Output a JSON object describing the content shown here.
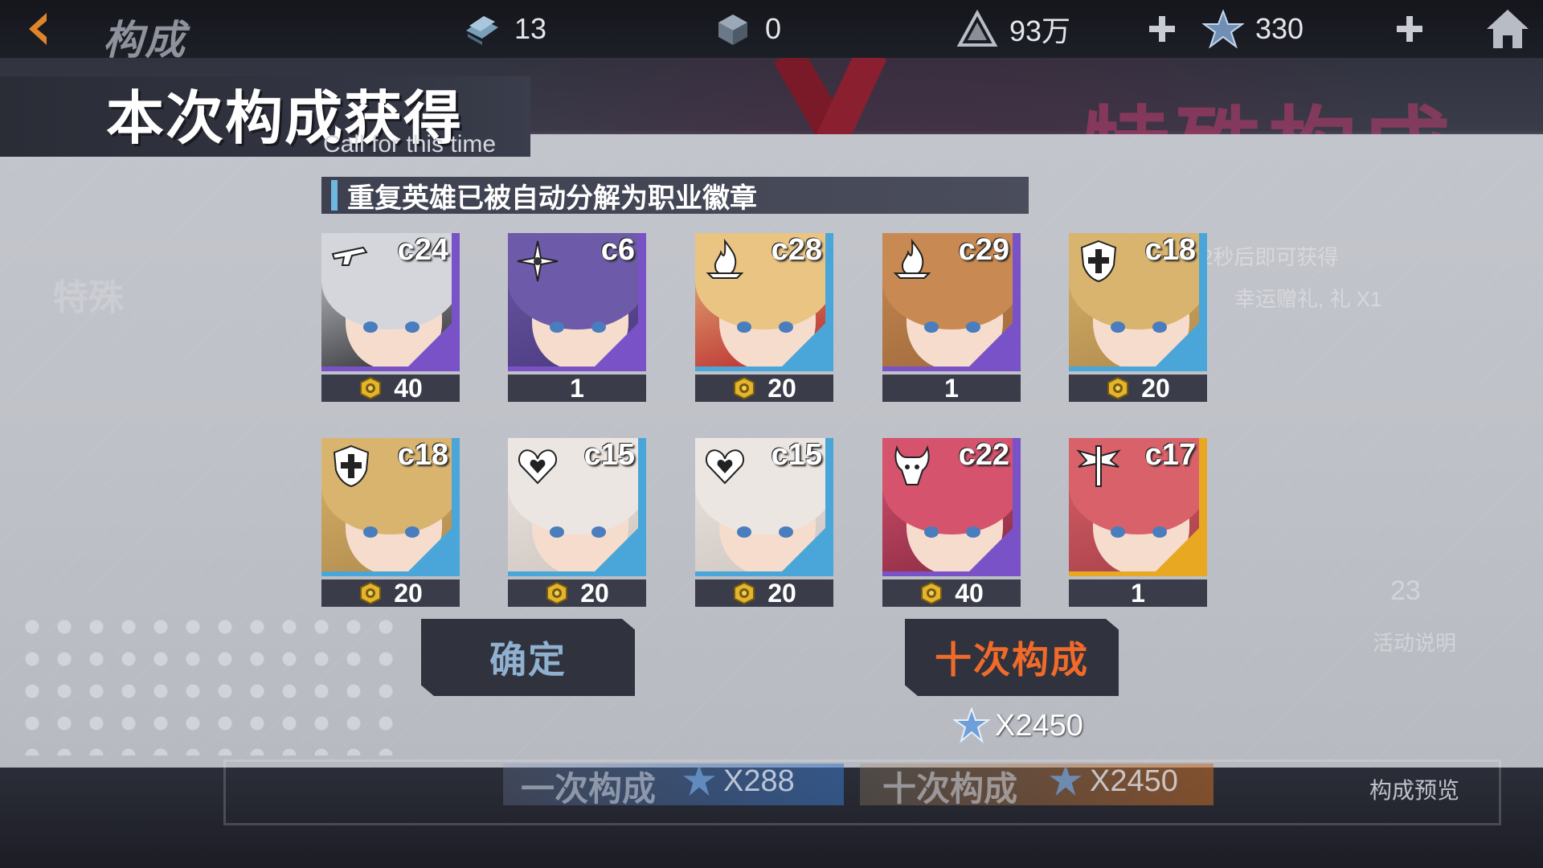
{
  "topbar": {
    "title": "构成",
    "resources": [
      {
        "icon": "card-stack-icon",
        "value": "13"
      },
      {
        "icon": "cube-icon",
        "value": "0"
      },
      {
        "icon": "gold-pyramid-icon",
        "value": "93万"
      },
      {
        "icon": "star-crystal-icon",
        "value": "330"
      }
    ]
  },
  "background": {
    "event_title": "特殊构成",
    "tab_special": "特殊",
    "event_desc_line1": "7分42秒后即可获得",
    "event_desc_line2": "幸运赠礼, 礼 X1",
    "activity_label": "活动说明",
    "calendar_number": "23"
  },
  "result": {
    "title": "本次构成获得",
    "subtitle": "Call for this time",
    "notice": "重复英雄已被自动分解为职业徽章",
    "cards": [
      {
        "code": "c24",
        "amount": "40",
        "has_badge": true,
        "class": "gunner-icon",
        "frame": "#7a52c8",
        "hair": "#d4d6dc",
        "accent": "#2a2a2e"
      },
      {
        "code": "c6",
        "amount": "1",
        "has_badge": false,
        "class": "shuriken-icon",
        "frame": "#7a52c8",
        "hair": "#6d5aa8",
        "accent": "#4a3a7e"
      },
      {
        "code": "c28",
        "amount": "20",
        "has_badge": true,
        "class": "flame-icon",
        "frame": "#4aa6d8",
        "hair": "#e9c483",
        "accent": "#b8232a"
      },
      {
        "code": "c29",
        "amount": "1",
        "has_badge": false,
        "class": "flame-icon",
        "frame": "#7a52c8",
        "hair": "#c88a52",
        "accent": "#a06a3c"
      },
      {
        "code": "c18",
        "amount": "20",
        "has_badge": true,
        "class": "shield-icon",
        "frame": "#4aa6d8",
        "hair": "#d9b46e",
        "accent": "#b08a4a"
      },
      {
        "code": "c18",
        "amount": "20",
        "has_badge": true,
        "class": "shield-icon",
        "frame": "#4aa6d8",
        "hair": "#d9b46e",
        "accent": "#b08a4a"
      },
      {
        "code": "c15",
        "amount": "20",
        "has_badge": true,
        "class": "heart-icon",
        "frame": "#4aa6d8",
        "hair": "#ece6e2",
        "accent": "#cfc6c0"
      },
      {
        "code": "c15",
        "amount": "20",
        "has_badge": true,
        "class": "heart-icon",
        "frame": "#4aa6d8",
        "hair": "#ece6e2",
        "accent": "#cfc6c0"
      },
      {
        "code": "c22",
        "amount": "40",
        "has_badge": true,
        "class": "demon-icon",
        "frame": "#7a52c8",
        "hair": "#d6536e",
        "accent": "#8a2a44"
      },
      {
        "code": "c17",
        "amount": "1",
        "has_badge": false,
        "class": "sword-wing-icon",
        "frame": "#e8a822",
        "hair": "#d9626a",
        "accent": "#a8404a"
      }
    ]
  },
  "buttons": {
    "confirm": "确定",
    "ten_call": "十次构成",
    "ten_call_cost": "X2450"
  },
  "bottom": {
    "single_label": "一次构成",
    "single_cost": "X288",
    "ten_label": "十次构成",
    "ten_cost": "X2450",
    "preview": "构成预览"
  },
  "colors": {
    "accent_blue": "#6fb7e0",
    "accent_orange": "#f06a2a",
    "frame_purple": "#7a52c8",
    "frame_blue": "#4aa6d8",
    "frame_gold": "#e8a822"
  }
}
